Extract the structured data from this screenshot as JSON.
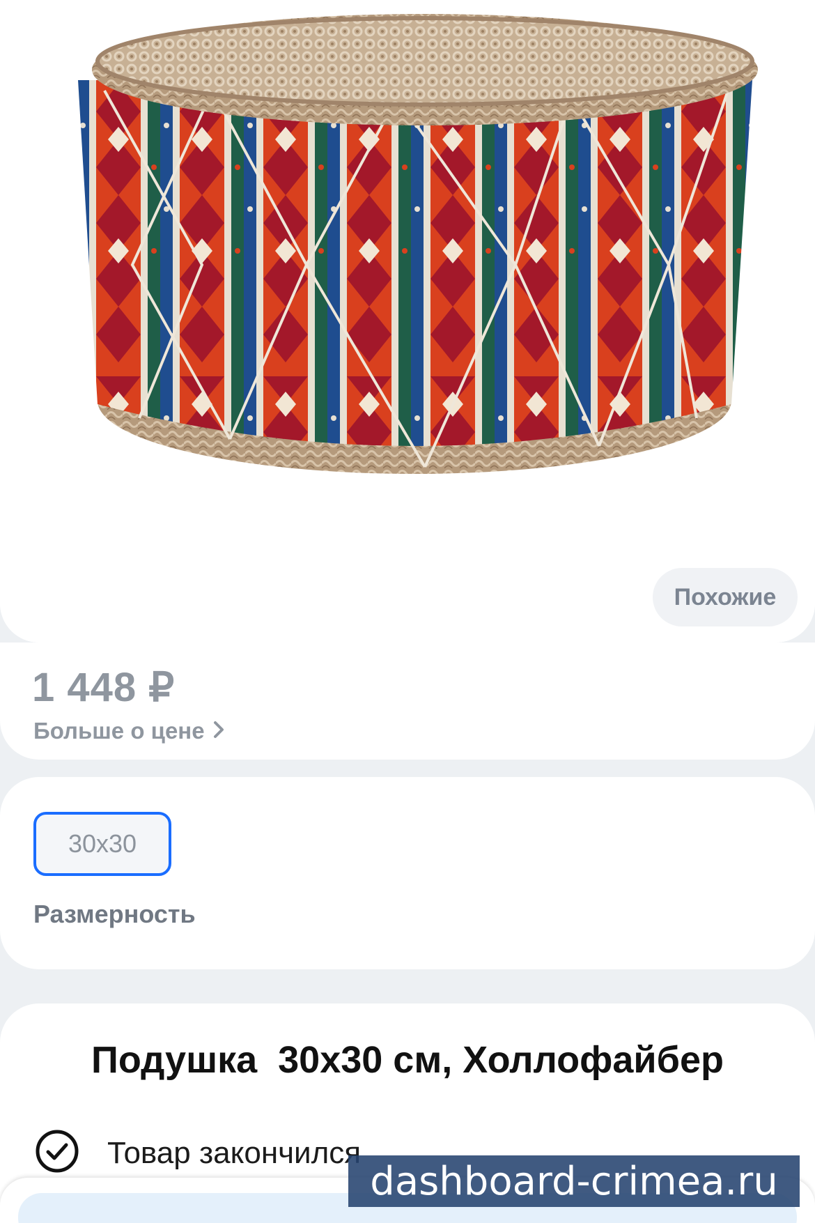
{
  "gallery": {
    "image_alt": "product-photo-woven-pouf",
    "similar_label": "Похожие"
  },
  "price": {
    "value": "1 448 ₽",
    "more_label": "Больше о цене",
    "more_icon": "chevron-right-icon"
  },
  "size": {
    "selected_option": "30x30",
    "label": "Размерность"
  },
  "product": {
    "title": "Подушка  30x30 см, Холлофайбер",
    "status_icon": "check-circle-icon",
    "status_text": "Товар закончился"
  },
  "watermark": {
    "text": "dashboard-crimea.ru"
  },
  "colors": {
    "accent": "#1a6dff",
    "muted_text": "#8f969f",
    "background": "#edf0f3",
    "watermark_bg": "#264370"
  }
}
